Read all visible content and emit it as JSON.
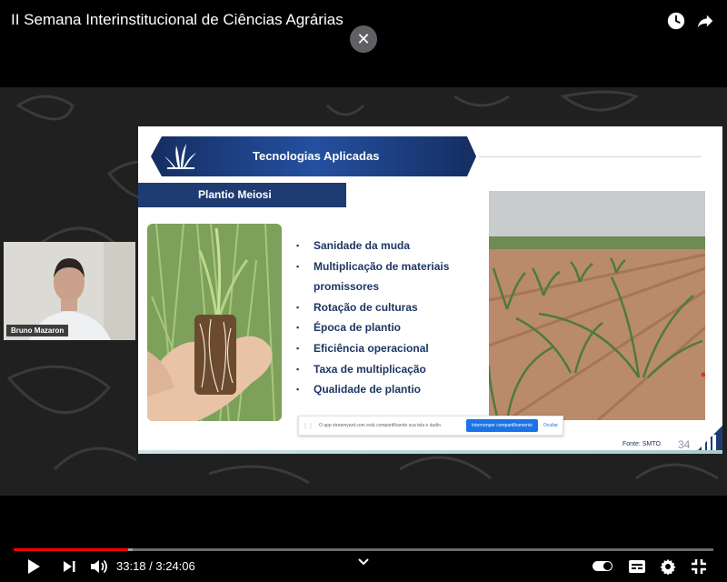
{
  "video": {
    "title": "II Semana Interinstitucional de Ciências Agrárias",
    "top_icons": [
      "watch-later-icon",
      "share-icon"
    ],
    "close_icon": "close-icon"
  },
  "participant": {
    "name": "Bruno Mazaron"
  },
  "slide": {
    "header": "Tecnologias Aplicadas",
    "subheader": "Plantio Meiosi",
    "bullets": [
      "Sanidade da muda",
      "Multiplicação de materiais promissores",
      "Rotação de culturas",
      "Época de plantio",
      "Eficiência operacional",
      "Taxa de multiplicação",
      "Qualidade de plantio"
    ],
    "source": "Fonte: SMTO",
    "page_number": "34"
  },
  "share_bar": {
    "message": "O app streamyard.com está compartilhando sua tela e áudio.",
    "stop_label": "Interromper compartilhamento",
    "hide_label": "Ocultar"
  },
  "player": {
    "current_time": "33:18",
    "duration": "3:24:06",
    "time_display": "33:18 / 3:24:06",
    "progress_fraction": 0.163,
    "buffered_fraction": 0.17,
    "accent_color": "#ff0000",
    "autoplay_on": true
  }
}
